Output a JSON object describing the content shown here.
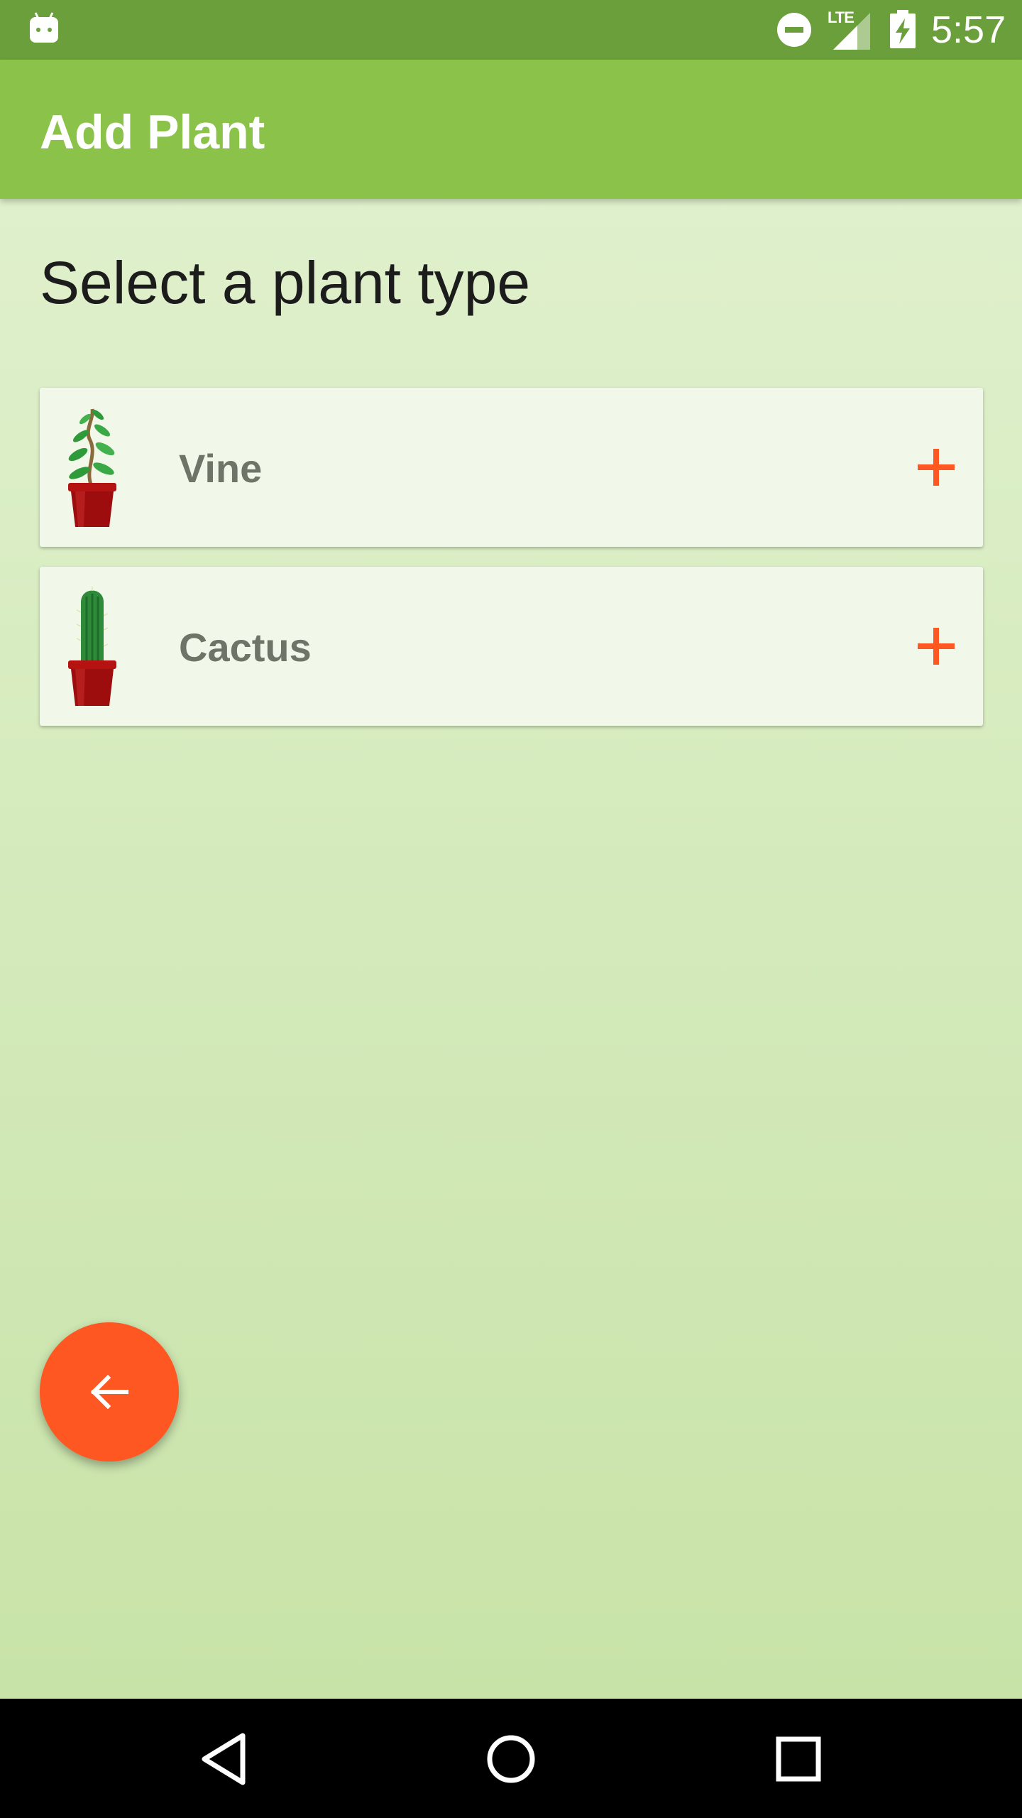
{
  "status_bar": {
    "time": "5:57",
    "network": "LTE",
    "icons": [
      "android-icon",
      "do-not-disturb-icon",
      "lte-signal-icon",
      "battery-charging-icon"
    ]
  },
  "app_bar": {
    "title": "Add Plant"
  },
  "main": {
    "heading": "Select a plant type",
    "plant_types": [
      {
        "name": "Vine",
        "icon": "vine-plant-icon",
        "action_icon": "add-icon"
      },
      {
        "name": "Cactus",
        "icon": "cactus-plant-icon",
        "action_icon": "add-icon"
      }
    ]
  },
  "fab": {
    "icon": "arrow-back-icon"
  },
  "nav_bar": {
    "buttons": [
      "back-icon",
      "home-icon",
      "recents-icon"
    ]
  },
  "colors": {
    "status_bar": "#6a9f3b",
    "app_bar": "#8bc34a",
    "accent": "#ff5722",
    "card_background": "#f1f8e9",
    "background_top": "#dff0cc",
    "background_bottom": "#c8e3a8"
  }
}
